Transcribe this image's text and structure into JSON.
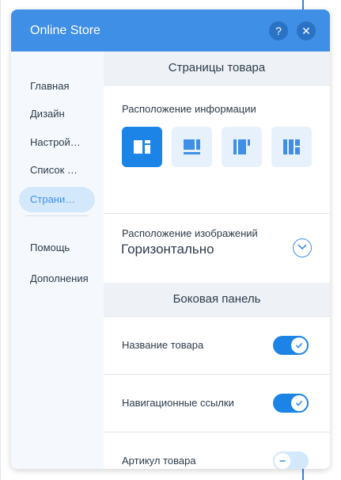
{
  "app": {
    "title": "Online Store",
    "help_label": "?",
    "close_label": "✕"
  },
  "sidebar": {
    "items": [
      {
        "label": "Главная"
      },
      {
        "label": "Дизайн"
      },
      {
        "label": "Настрой…"
      },
      {
        "label": "Список …"
      },
      {
        "label": "Страни…",
        "active": true
      }
    ],
    "bottom_items": [
      {
        "label": "Помощь"
      },
      {
        "label": "Дополнения"
      }
    ]
  },
  "main": {
    "section_title": "Страницы товара",
    "info_layout": {
      "label": "Расположение информации",
      "options": [
        "info-left-layout-icon",
        "info-top-layout-icon",
        "info-center-layout-icon",
        "info-columns-layout-icon"
      ],
      "selected_index": 0
    },
    "image_layout": {
      "label": "Расположение изображений",
      "value": "Горизонтально"
    },
    "sidebar_section_title": "Боковая панель",
    "toggles": [
      {
        "label": "Название товара",
        "on": true
      },
      {
        "label": "Навигационные ссылки",
        "on": true
      },
      {
        "label": "Артикул товара",
        "on": false
      }
    ]
  },
  "colors": {
    "accent": "#3f8fe6",
    "toggle_on": "#1c84e6",
    "toggle_off": "#d3e8fb"
  }
}
